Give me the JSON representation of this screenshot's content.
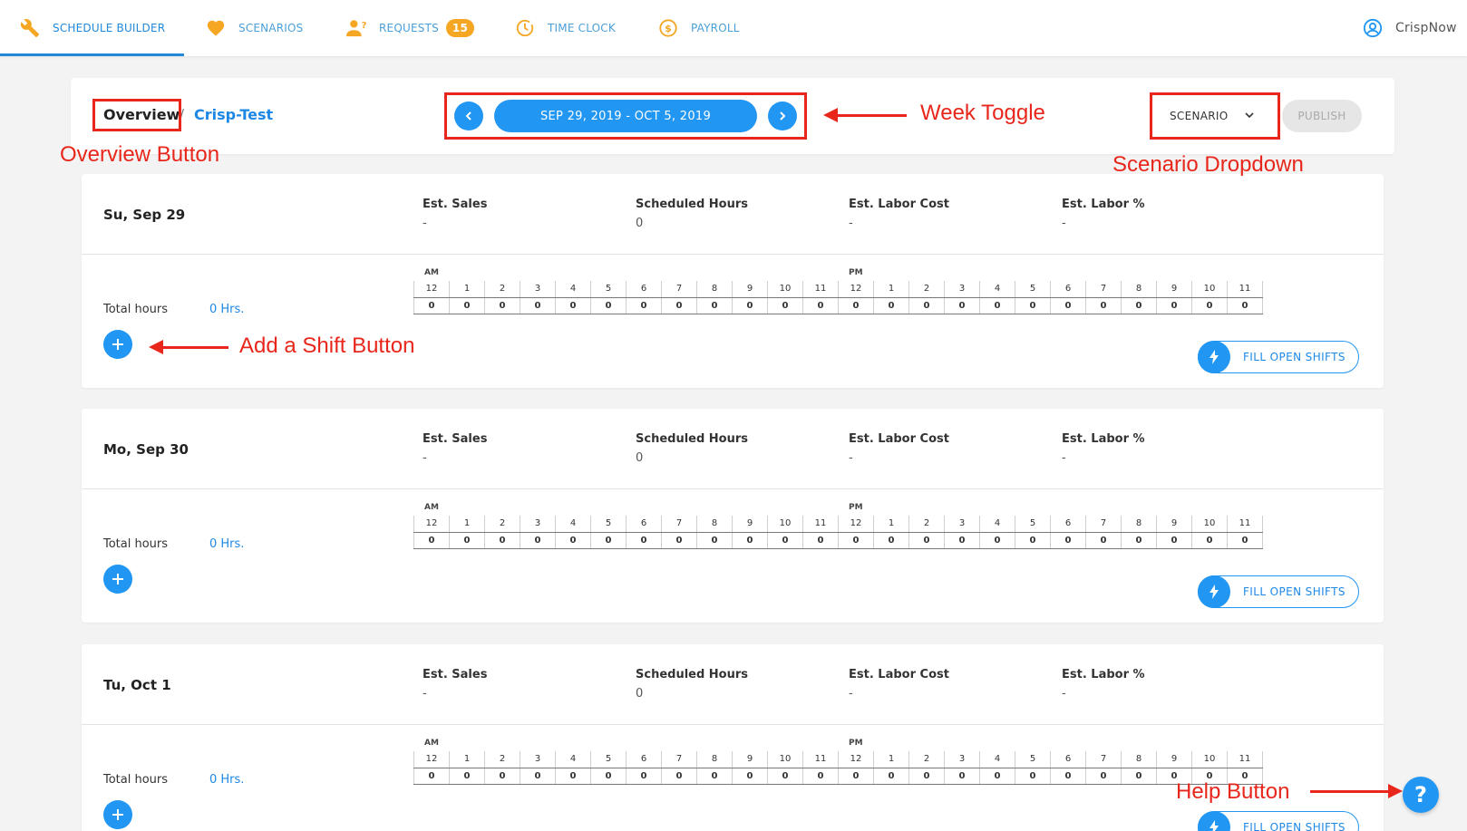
{
  "nav": {
    "items": [
      {
        "label": "SCHEDULE BUILDER",
        "icon": "wrench-icon"
      },
      {
        "label": "SCENARIOS",
        "icon": "heart-icon"
      },
      {
        "label": "REQUESTS",
        "icon": "user-question-icon",
        "badge": "15"
      },
      {
        "label": "TIME CLOCK",
        "icon": "clock-icon"
      },
      {
        "label": "PAYROLL",
        "icon": "dollar-coin-icon"
      }
    ],
    "user": {
      "name": "CrispNow",
      "icon": "user-circle-icon"
    }
  },
  "header": {
    "overview_label": "Overview",
    "separator": "/",
    "location_name": "Crisp-Test",
    "week_range": "SEP 29, 2019 - OCT 5, 2019",
    "prev_icon": "chevron-left-icon",
    "next_icon": "chevron-right-icon",
    "scenario_label": "SCENARIO",
    "publish_label": "PUBLISH"
  },
  "stat_labels": {
    "sales": "Est. Sales",
    "hours": "Scheduled Hours",
    "labor_cost": "Est. Labor Cost",
    "labor_pct": "Est. Labor %"
  },
  "hour_labels": [
    "12",
    "1",
    "2",
    "3",
    "4",
    "5",
    "6",
    "7",
    "8",
    "9",
    "10",
    "11",
    "12",
    "1",
    "2",
    "3",
    "4",
    "5",
    "6",
    "7",
    "8",
    "9",
    "10",
    "11"
  ],
  "am_label": "AM",
  "pm_label": "PM",
  "total_hours_label": "Total hours",
  "fill_label": "FILL OPEN SHIFTS",
  "days": [
    {
      "date": "Su, Sep 29",
      "sales": "-",
      "hours": "0",
      "labor_cost": "-",
      "labor_pct": "-",
      "total": "0 Hrs.",
      "values": [
        "0",
        "0",
        "0",
        "0",
        "0",
        "0",
        "0",
        "0",
        "0",
        "0",
        "0",
        "0",
        "0",
        "0",
        "0",
        "0",
        "0",
        "0",
        "0",
        "0",
        "0",
        "0",
        "0",
        "0"
      ]
    },
    {
      "date": "Mo, Sep 30",
      "sales": "-",
      "hours": "0",
      "labor_cost": "-",
      "labor_pct": "-",
      "total": "0 Hrs.",
      "values": [
        "0",
        "0",
        "0",
        "0",
        "0",
        "0",
        "0",
        "0",
        "0",
        "0",
        "0",
        "0",
        "0",
        "0",
        "0",
        "0",
        "0",
        "0",
        "0",
        "0",
        "0",
        "0",
        "0",
        "0"
      ]
    },
    {
      "date": "Tu, Oct 1",
      "sales": "-",
      "hours": "0",
      "labor_cost": "-",
      "labor_pct": "-",
      "total": "0 Hrs.",
      "values": [
        "0",
        "0",
        "0",
        "0",
        "0",
        "0",
        "0",
        "0",
        "0",
        "0",
        "0",
        "0",
        "0",
        "0",
        "0",
        "0",
        "0",
        "0",
        "0",
        "0",
        "0",
        "0",
        "0",
        "0"
      ]
    }
  ],
  "annotations": {
    "overview": "Overview Button",
    "week": "Week Toggle",
    "scenario": "Scenario Dropdown",
    "add_shift": "Add a Shift Button",
    "help": "Help Button"
  },
  "colors": {
    "accent": "#2196f3",
    "annotation": "#e8261b",
    "badge": "#f5a623",
    "nav_icon": "#f5a623"
  }
}
